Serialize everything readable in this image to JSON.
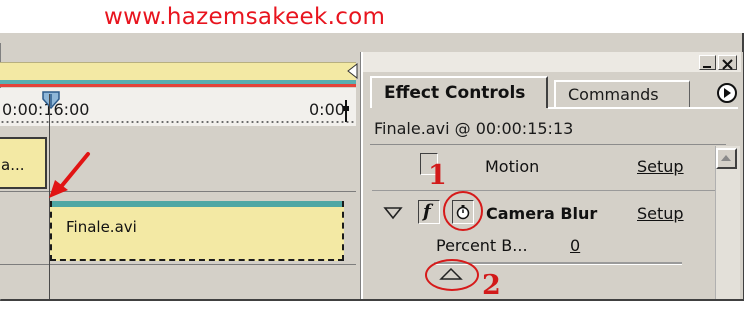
{
  "watermark": "www.hazemsakeek.com",
  "timeline": {
    "time_left": "0:00:16:00",
    "time_right": "0:00",
    "prev_clip_label": "a...",
    "clip_label": "Finale.avi"
  },
  "panel": {
    "tabs": [
      {
        "label": "Effect Controls",
        "active": true
      },
      {
        "label": "Commands",
        "active": false
      }
    ],
    "clip_info": "Finale.avi @ 00:00:15:13",
    "effects": [
      {
        "name": "Motion",
        "setup_label": "Setup"
      },
      {
        "name": "Camera Blur",
        "setup_label": "Setup",
        "f_label": "f"
      }
    ],
    "param": {
      "label": "Percent B...",
      "value": "0"
    }
  },
  "annotations": {
    "one": "1",
    "two": "2"
  },
  "colors": {
    "clip_fill": "#f3e9a4",
    "panel_bg": "#d4d0c8",
    "annotation_red": "#d21a1a",
    "teal": "#4fa7a4"
  }
}
